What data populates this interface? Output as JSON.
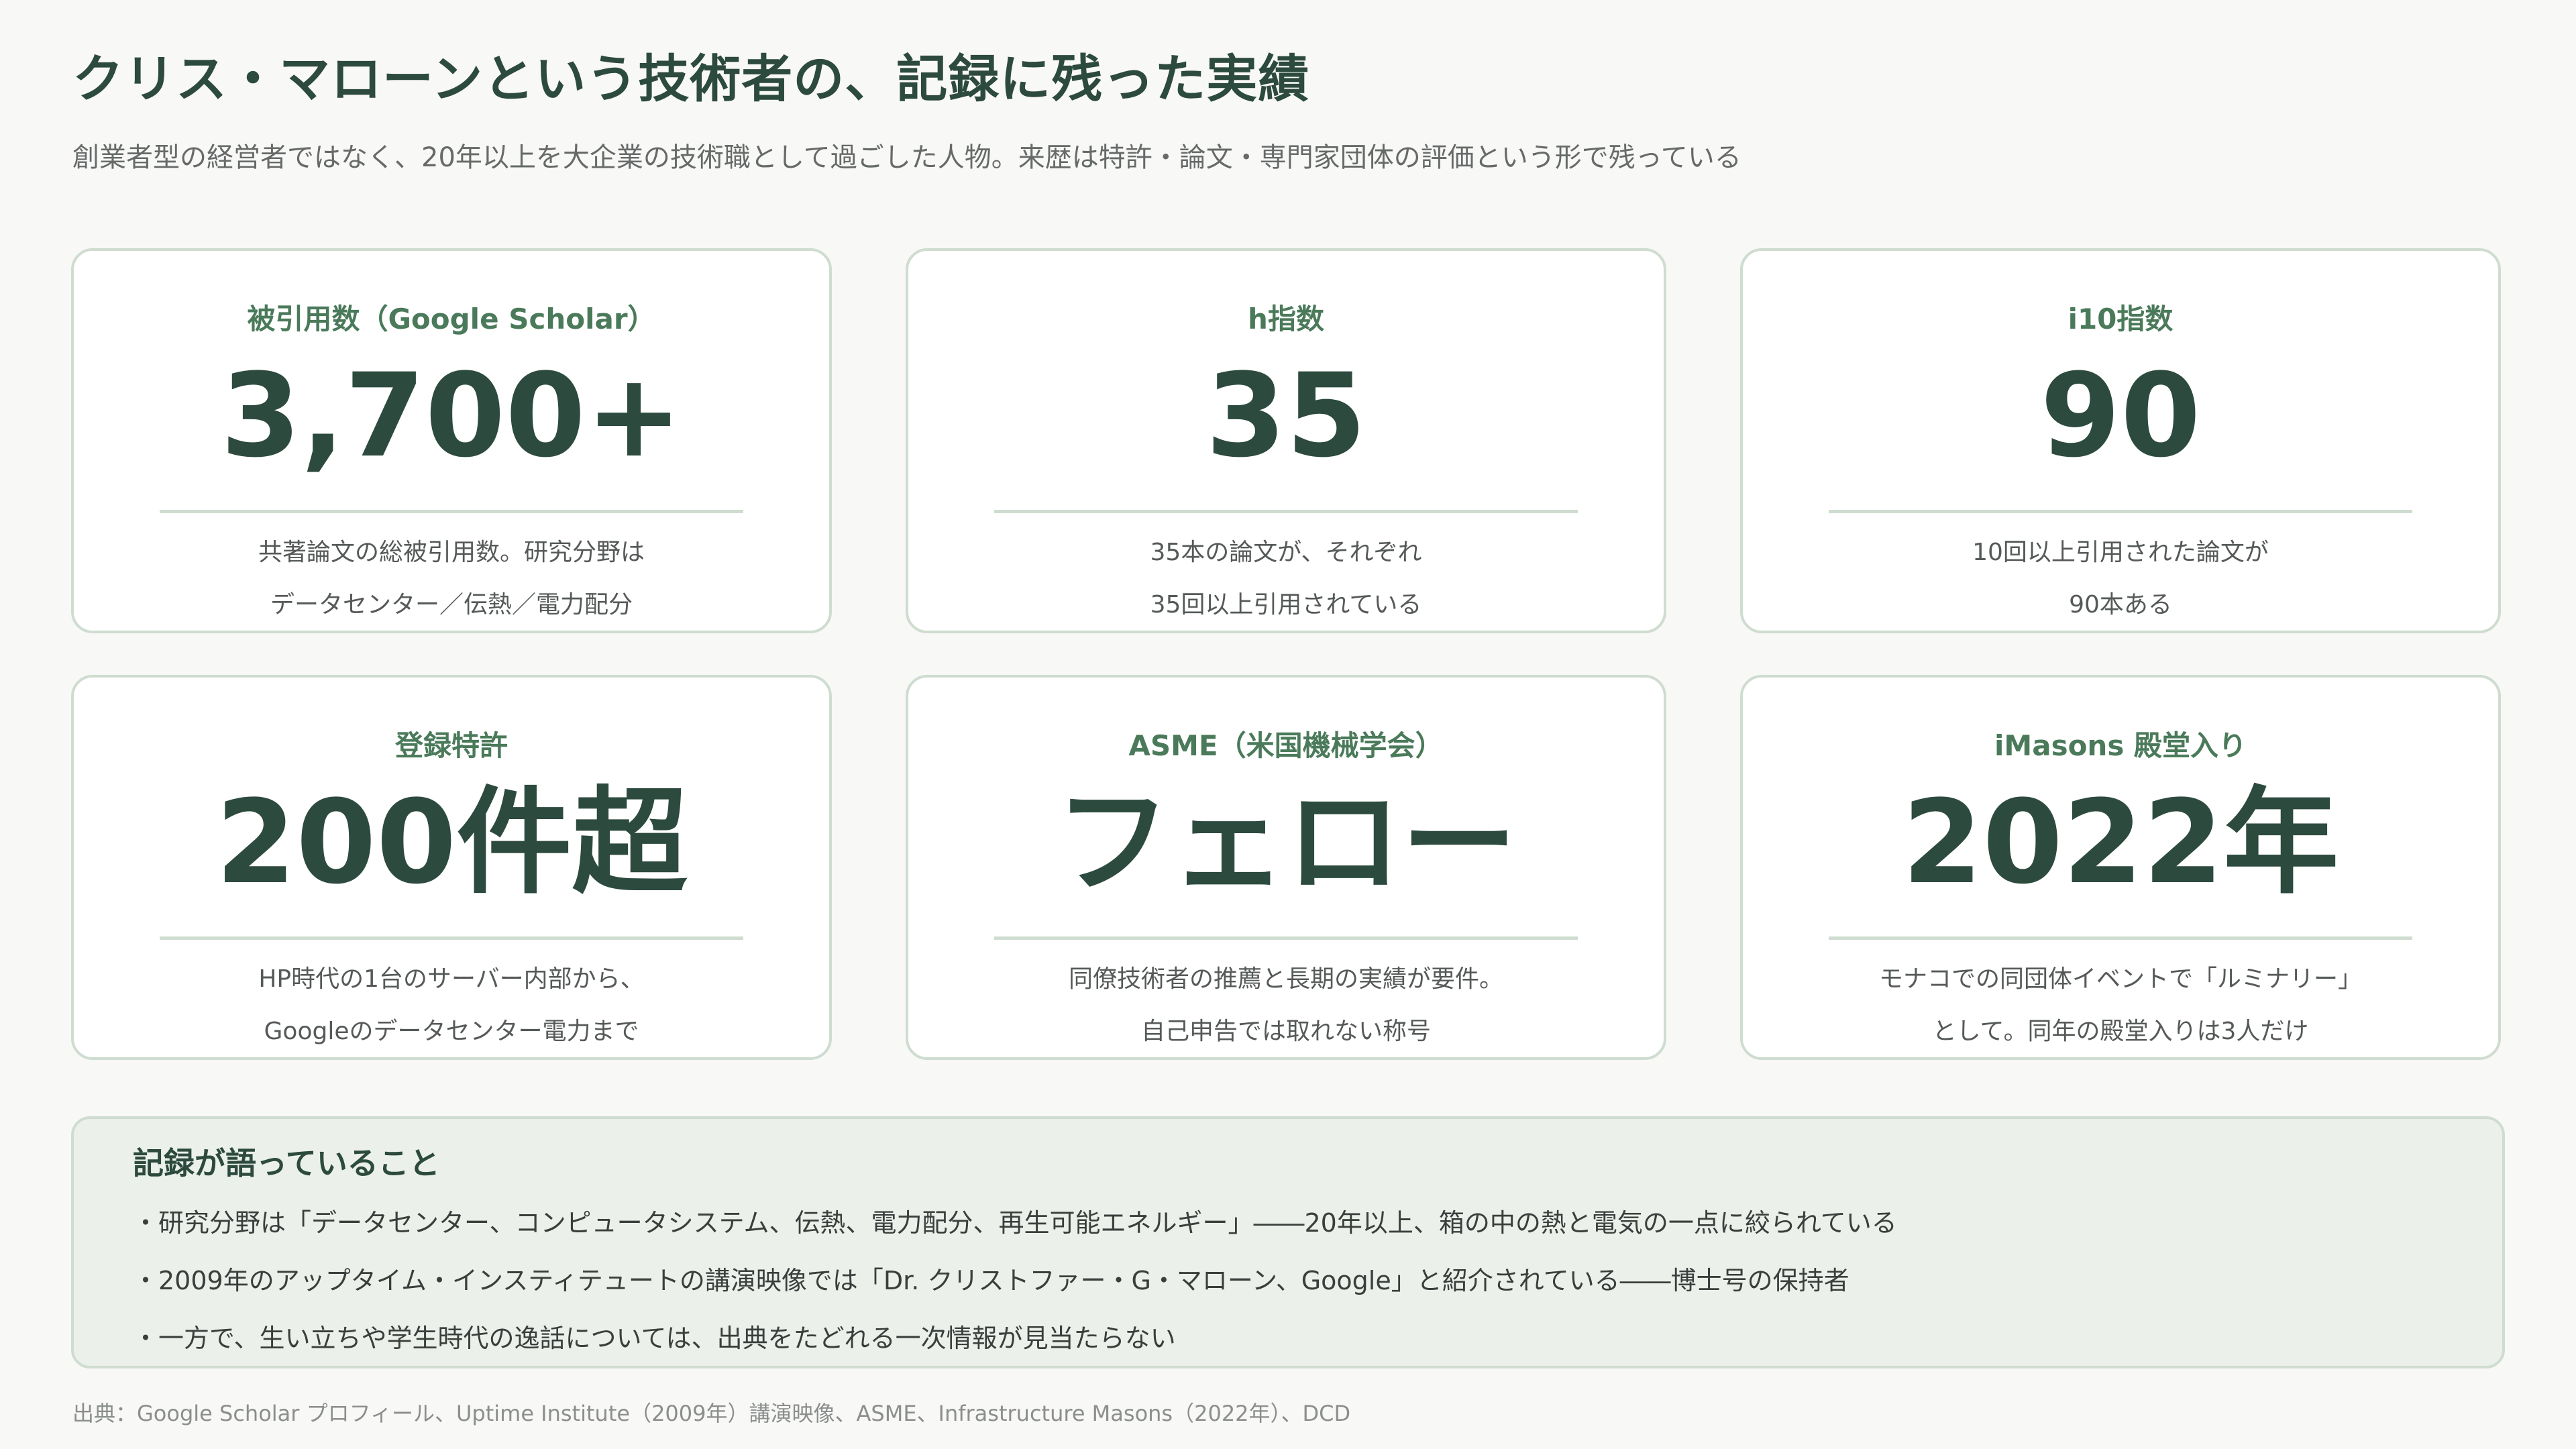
{
  "header": {
    "title": "クリス・マローンという技術者の、記録に残った実績",
    "subtitle": "創業者型の経営者ではなく、20年以上を大企業の技術職として過ごした人物。来歴は特許・論文・専門家団体の評価という形で残っている"
  },
  "cards": [
    {
      "label": "被引用数（Google Scholar）",
      "value": "3,700+",
      "desc_line1": "共著論文の総被引用数。研究分野は",
      "desc_line2": "データセンター／伝熱／電力配分"
    },
    {
      "label": "h指数",
      "value": "35",
      "desc_line1": "35本の論文が、それぞれ",
      "desc_line2": "35回以上引用されている"
    },
    {
      "label": "i10指数",
      "value": "90",
      "desc_line1": "10回以上引用された論文が",
      "desc_line2": "90本ある"
    },
    {
      "label": "登録特許",
      "value": "200件超",
      "desc_line1": "HP時代の1台のサーバー内部から、",
      "desc_line2": "Googleのデータセンター電力まで"
    },
    {
      "label": "ASME（米国機械学会）",
      "value": "フェロー",
      "desc_line1": "同僚技術者の推薦と長期の実績が要件。",
      "desc_line2": "自己申告では取れない称号"
    },
    {
      "label": "iMasons 殿堂入り",
      "value": "2022年",
      "desc_line1": "モナコでの同団体イベントで「ルミナリー」",
      "desc_line2": "として。同年の殿堂入りは3人だけ"
    }
  ],
  "summary": {
    "heading": "記録が語っていること",
    "items": [
      "・研究分野は「データセンター、コンピュータシステム、伝熱、電力配分、再生可能エネルギー」――20年以上、箱の中の熱と電気の一点に絞られている",
      "・2009年のアップタイム・インスティテュートの講演映像では「Dr. クリストファー・G・マローン、Google」と紹介されている――博士号の保持者",
      "・一方で、生い立ちや学生時代の逸話については、出典をたどれる一次情報が見当たらない"
    ]
  },
  "source": "出典：Google Scholar プロフィール、Uptime Institute（2009年）講演映像、ASME、Infrastructure Masons（2022年）、DCD"
}
